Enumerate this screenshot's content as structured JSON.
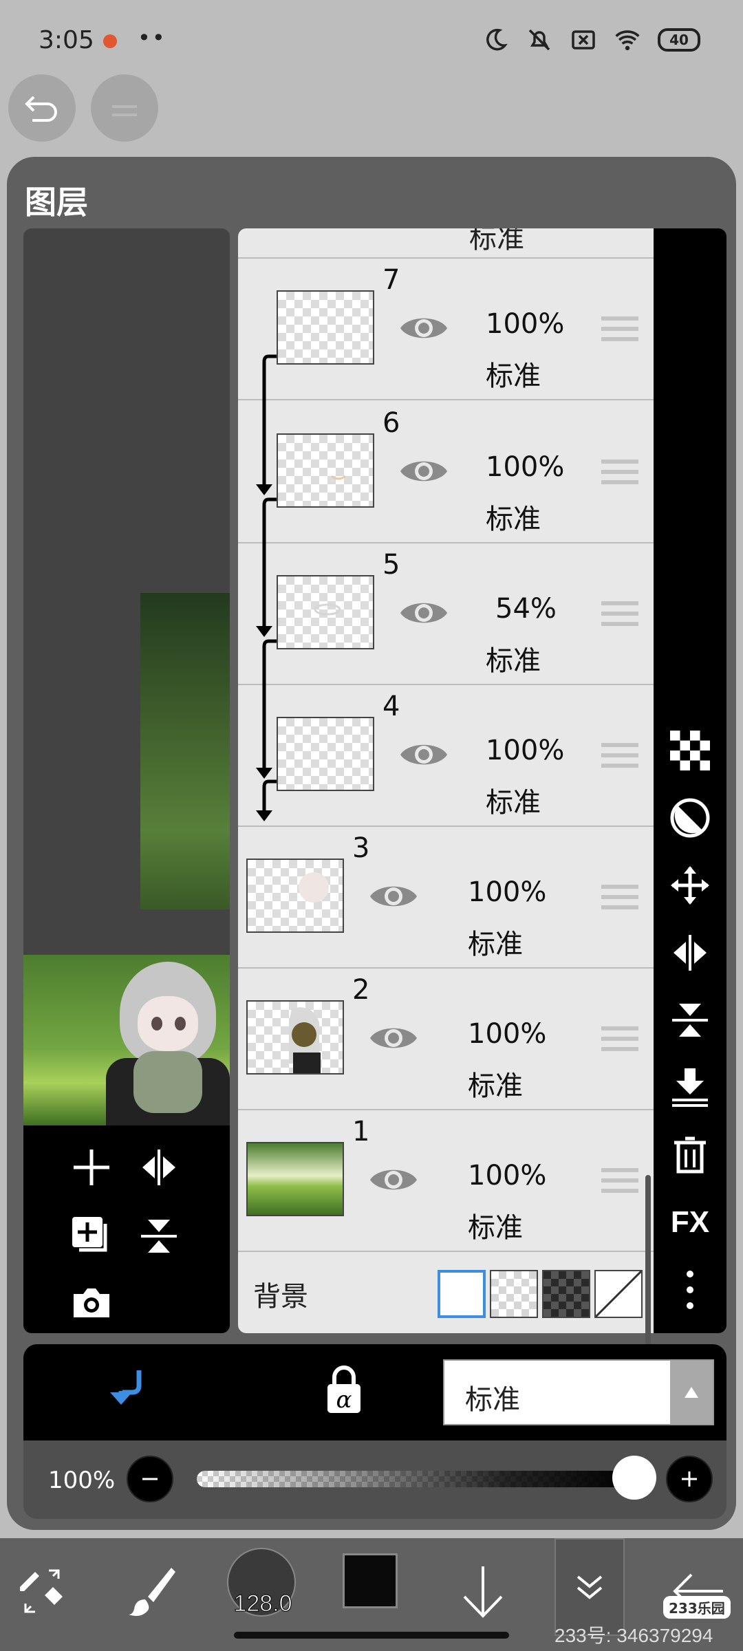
{
  "status": {
    "time": "3:05",
    "dots": "••",
    "battery": "40"
  },
  "panel": {
    "title": "图层"
  },
  "layers": {
    "top_partial_mode": "标准",
    "items": [
      {
        "num": "7",
        "opacity": "100%",
        "mode": "标准"
      },
      {
        "num": "6",
        "opacity": "100%",
        "mode": "标准"
      },
      {
        "num": "5",
        "opacity": "54%",
        "mode": "标准"
      },
      {
        "num": "4",
        "opacity": "100%",
        "mode": "标准"
      },
      {
        "num": "3",
        "opacity": "100%",
        "mode": "标准"
      },
      {
        "num": "2",
        "opacity": "100%",
        "mode": "标准"
      },
      {
        "num": "1",
        "opacity": "100%",
        "mode": "标准"
      }
    ],
    "background_label": "背景"
  },
  "right_tools": {
    "fx": "FX"
  },
  "blend": {
    "selected": "标准"
  },
  "opacity": {
    "value": "100%"
  },
  "brush": {
    "size": "128.0"
  },
  "footer": {
    "badge": "233乐园",
    "watermark": "233号: 346379294"
  },
  "colors": {
    "accent": "#3d8ee0",
    "panel": "#5f5f5f",
    "list_bg": "#e8e8e8"
  }
}
